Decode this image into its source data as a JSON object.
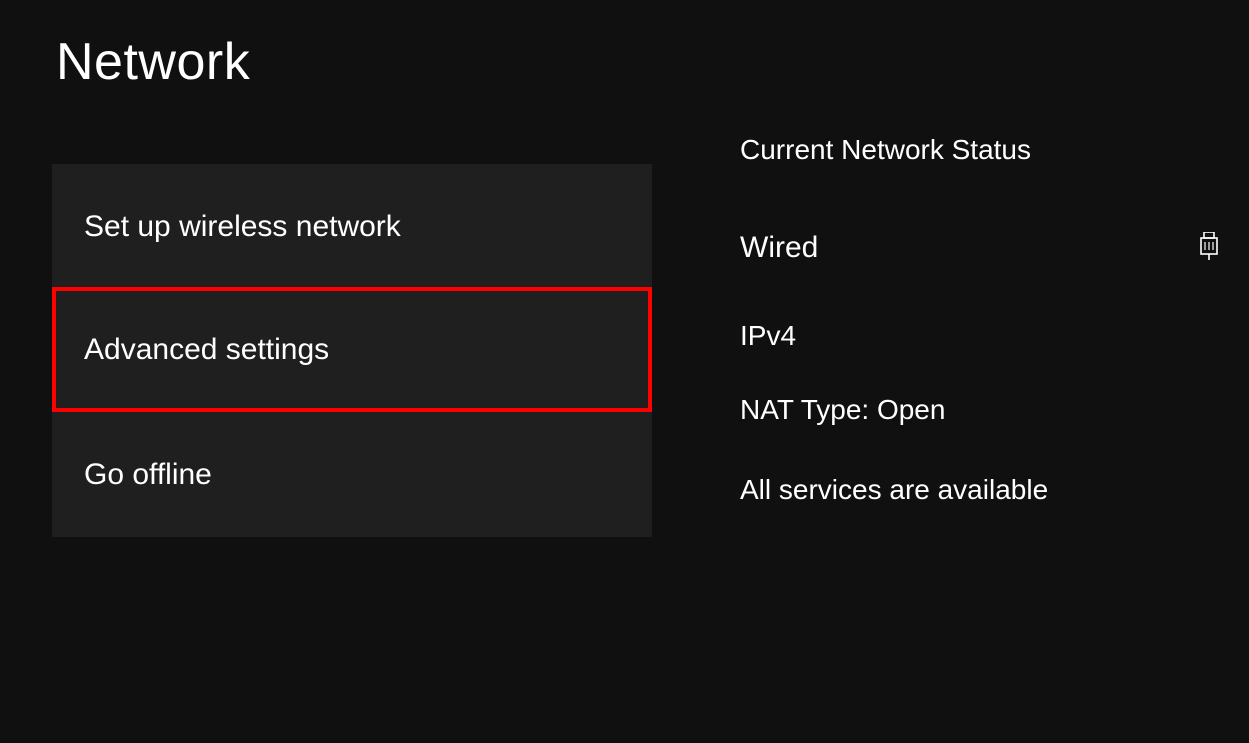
{
  "header": {
    "title": "Network"
  },
  "menu": {
    "items": [
      {
        "label": "Set up wireless network",
        "highlighted": false
      },
      {
        "label": "Advanced settings",
        "highlighted": true
      },
      {
        "label": "Go offline",
        "highlighted": false
      }
    ]
  },
  "status": {
    "heading": "Current Network Status",
    "connection_type": "Wired",
    "connection_icon": "ethernet-plug-icon",
    "ip_version": "IPv4",
    "nat_type": "NAT Type: Open",
    "services": "All services are available"
  }
}
